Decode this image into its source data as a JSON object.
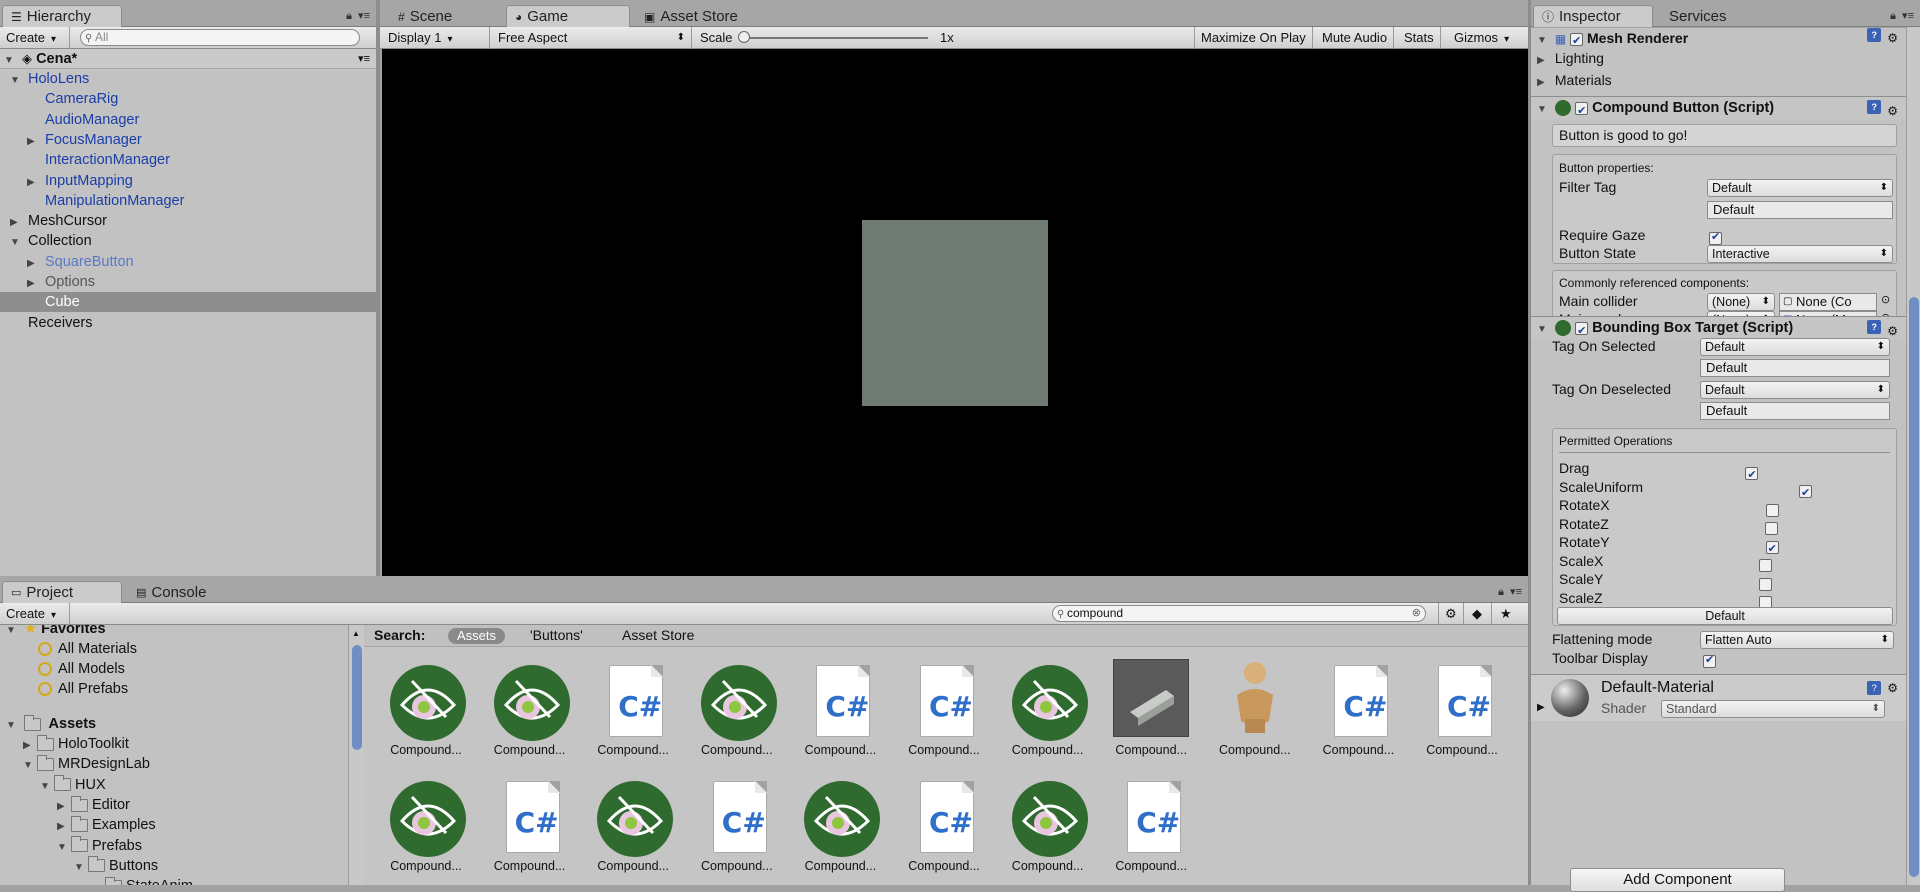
{
  "hierarchy": {
    "tab": "Hierarchy",
    "create": "Create",
    "search_placeholder": "All",
    "scene": "Cena*",
    "items": [
      {
        "label": "HoloLens",
        "indent": 1,
        "expander": "open",
        "style": "blue"
      },
      {
        "label": "CameraRig",
        "indent": 2,
        "expander": "none",
        "style": "blue"
      },
      {
        "label": "AudioManager",
        "indent": 2,
        "expander": "none",
        "style": "blue"
      },
      {
        "label": "FocusManager",
        "indent": 2,
        "expander": "closed",
        "style": "blue"
      },
      {
        "label": "InteractionManager",
        "indent": 2,
        "expander": "none",
        "style": "blue"
      },
      {
        "label": "InputMapping",
        "indent": 2,
        "expander": "closed",
        "style": "blue"
      },
      {
        "label": "ManipulationManager",
        "indent": 2,
        "expander": "none",
        "style": "blue"
      },
      {
        "label": "MeshCursor",
        "indent": 1,
        "expander": "closed",
        "style": "normal"
      },
      {
        "label": "Collection",
        "indent": 1,
        "expander": "open",
        "style": "normal"
      },
      {
        "label": "SquareButton",
        "indent": 2,
        "expander": "closed",
        "style": "lblue"
      },
      {
        "label": "Options",
        "indent": 2,
        "expander": "closed",
        "style": "gray"
      },
      {
        "label": "Cube",
        "indent": 2,
        "expander": "none",
        "style": "selected"
      },
      {
        "label": "Receivers",
        "indent": 1,
        "expander": "none",
        "style": "normal"
      }
    ]
  },
  "center_tabs": {
    "scene": "Scene",
    "game": "Game",
    "asset_store": "Asset Store"
  },
  "game_toolbar": {
    "display": "Display 1",
    "aspect": "Free Aspect",
    "scale_label": "Scale",
    "scale_value": "1x",
    "maximize": "Maximize On Play",
    "mute": "Mute Audio",
    "stats": "Stats",
    "gizmos": "Gizmos"
  },
  "inspector": {
    "tab": "Inspector",
    "services_tab": "Services",
    "mesh_renderer": {
      "title": "Mesh Renderer",
      "lighting": "Lighting",
      "materials": "Materials"
    },
    "compound_button": {
      "title": "Compound Button (Script)",
      "status": "Button is good to go!",
      "props_title": "Button properties:",
      "filter_tag_label": "Filter Tag",
      "filter_tag_value": "Default",
      "filter_tag_field": "Default",
      "require_gaze_label": "Require Gaze",
      "button_state_label": "Button State",
      "button_state_value": "Interactive",
      "common_title": "Commonly referenced components:",
      "main_collider_label": "Main collider",
      "main_collider_pop": "(None)",
      "main_collider_obj": "None (Co",
      "main_renderer_label": "Main renderer",
      "main_renderer_pop": "(None)",
      "main_renderer_obj": "None (Me"
    },
    "bounding_box": {
      "title": "Bounding Box Target (Script)",
      "tag_selected_label": "Tag On Selected",
      "tag_selected_value": "Default",
      "tag_selected_field": "Default",
      "tag_deselected_label": "Tag On Deselected",
      "tag_deselected_value": "Default",
      "tag_deselected_field": "Default",
      "permitted_title": "Permitted Operations",
      "operations": [
        {
          "label": "Drag",
          "checked": true
        },
        {
          "label": "ScaleUniform",
          "checked": true
        },
        {
          "label": "RotateX",
          "checked": false
        },
        {
          "label": "RotateZ",
          "checked": false
        },
        {
          "label": "RotateY",
          "checked": true
        },
        {
          "label": "ScaleX",
          "checked": false
        },
        {
          "label": "ScaleY",
          "checked": false
        },
        {
          "label": "ScaleZ",
          "checked": false
        }
      ],
      "default_button": "Default",
      "flattening_label": "Flattening mode",
      "flattening_value": "Flatten Auto",
      "toolbar_label": "Toolbar Display"
    },
    "material": {
      "name": "Default-Material",
      "shader_label": "Shader",
      "shader_value": "Standard"
    },
    "add_component": "Add Component"
  },
  "project": {
    "tab": "Project",
    "console_tab": "Console",
    "create": "Create",
    "search_value": "compound",
    "favorites": "Favorites",
    "fav_items": [
      "All Materials",
      "All Models",
      "All Prefabs"
    ],
    "assets_root": "Assets",
    "tree": [
      {
        "label": "HoloToolkit",
        "indent": 1,
        "expander": "closed"
      },
      {
        "label": "MRDesignLab",
        "indent": 1,
        "expander": "open"
      },
      {
        "label": "HUX",
        "indent": 2,
        "expander": "open"
      },
      {
        "label": "Editor",
        "indent": 3,
        "expander": "closed"
      },
      {
        "label": "Examples",
        "indent": 3,
        "expander": "closed"
      },
      {
        "label": "Prefabs",
        "indent": 3,
        "expander": "open"
      },
      {
        "label": "Buttons",
        "indent": 4,
        "expander": "open"
      },
      {
        "label": "StateAnim",
        "indent": 5,
        "expander": "none"
      }
    ],
    "search_label": "Search:",
    "scope_assets": "Assets",
    "scope_buttons": "'Buttons'",
    "scope_store": "Asset Store",
    "assets": [
      {
        "label": "Compound...",
        "kind": "eye"
      },
      {
        "label": "Compound...",
        "kind": "eye"
      },
      {
        "label": "Compound...",
        "kind": "cs"
      },
      {
        "label": "Compound...",
        "kind": "eye"
      },
      {
        "label": "Compound...",
        "kind": "cs"
      },
      {
        "label": "Compound...",
        "kind": "cs"
      },
      {
        "label": "Compound...",
        "kind": "eye"
      },
      {
        "label": "Compound...",
        "kind": "mesh"
      },
      {
        "label": "Compound...",
        "kind": "figure"
      },
      {
        "label": "Compound...",
        "kind": "cs"
      },
      {
        "label": "Compound...",
        "kind": "cs"
      },
      {
        "label": "Compound...",
        "kind": "eye"
      },
      {
        "label": "Compound...",
        "kind": "cs"
      },
      {
        "label": "Compound...",
        "kind": "eye"
      },
      {
        "label": "Compound...",
        "kind": "cs"
      },
      {
        "label": "Compound...",
        "kind": "eye"
      },
      {
        "label": "Compound...",
        "kind": "cs"
      },
      {
        "label": "Compound...",
        "kind": "eye"
      },
      {
        "label": "Compound...",
        "kind": "cs"
      }
    ]
  },
  "colors": {
    "cube": "#6f7a72",
    "game_bg": "#000000",
    "selected_row": "#8e8e8e"
  }
}
